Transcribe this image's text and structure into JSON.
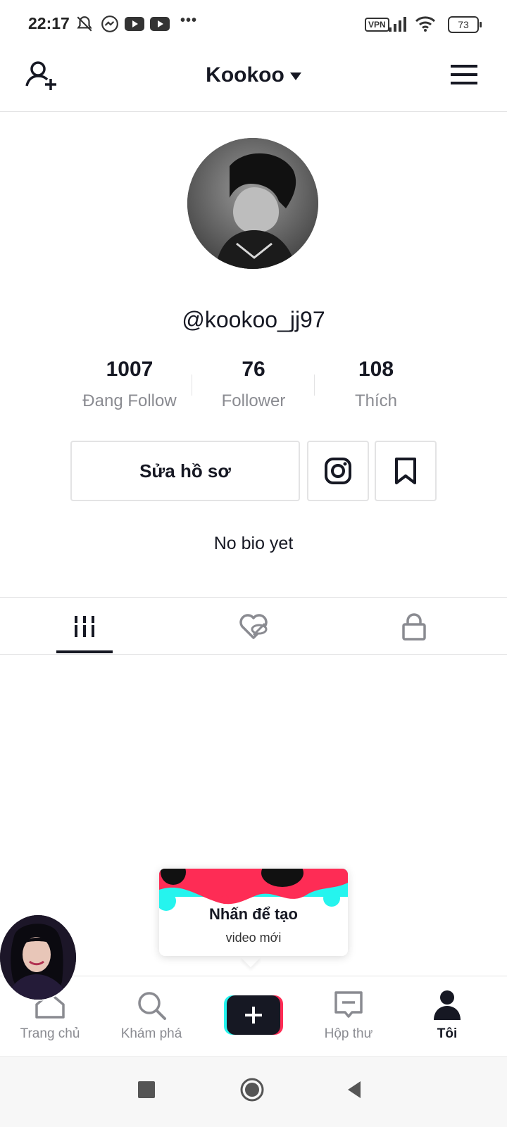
{
  "status_bar": {
    "time": "22:17",
    "vpn": "VPN",
    "battery": "73",
    "more": "•••"
  },
  "header": {
    "title": "Kookoo"
  },
  "profile": {
    "username": "@kookoo_jj97",
    "bio": "No bio yet"
  },
  "stats": [
    {
      "value": "1007",
      "label": "Đang Follow"
    },
    {
      "value": "76",
      "label": "Follower"
    },
    {
      "value": "108",
      "label": "Thích"
    }
  ],
  "actions": {
    "edit_profile": "Sửa hồ sơ"
  },
  "tooltip": {
    "title": "Nhấn để tạo",
    "subtitle": "video mới"
  },
  "bottom_nav": [
    {
      "label": "Trang chủ",
      "icon": "home-icon"
    },
    {
      "label": "Khám phá",
      "icon": "search-icon"
    },
    {
      "label": "",
      "icon": "plus-icon"
    },
    {
      "label": "Hộp thư",
      "icon": "inbox-icon"
    },
    {
      "label": "Tôi",
      "icon": "profile-icon"
    }
  ],
  "colors": {
    "primary_text": "#161823",
    "secondary_text": "#8a8b91",
    "divider": "#e3e3e4",
    "cyan": "#25f4ee",
    "red": "#fe2c55"
  }
}
